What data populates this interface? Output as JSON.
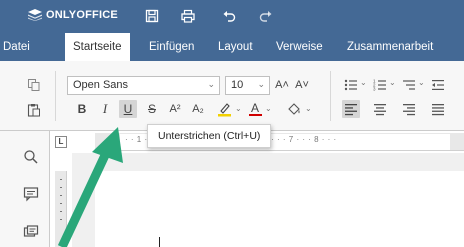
{
  "app": {
    "logo_text": "ONLYOFFICE"
  },
  "menu": {
    "items": [
      {
        "label": "Datei"
      },
      {
        "label": "Startseite"
      },
      {
        "label": "Einfügen"
      },
      {
        "label": "Layout"
      },
      {
        "label": "Verweise"
      },
      {
        "label": "Zusammenarbeit"
      }
    ]
  },
  "toolbar": {
    "font_name": "Open Sans",
    "font_size": "10",
    "font_grow_label": "A˄",
    "font_shrink_label": "A˅",
    "bold_label": "B",
    "italic_label": "I",
    "underline_label": "U",
    "strike_label": "S",
    "superscript_label": "A²",
    "subscript_label": "A₂",
    "font_color_label": "A",
    "highlight_color": "#f2d000",
    "font_color": "#d00000"
  },
  "tooltip": {
    "text": "Unterstrichen (Ctrl+U)"
  },
  "ruler": {
    "marks": "· · 1 · · · 2 · · · 3 · · · 4 · · · 5 · · · 6 · · · 7 · · · 8 · · ·"
  },
  "colors": {
    "header": "#446995",
    "annotation_arrow": "#2aa77a"
  }
}
